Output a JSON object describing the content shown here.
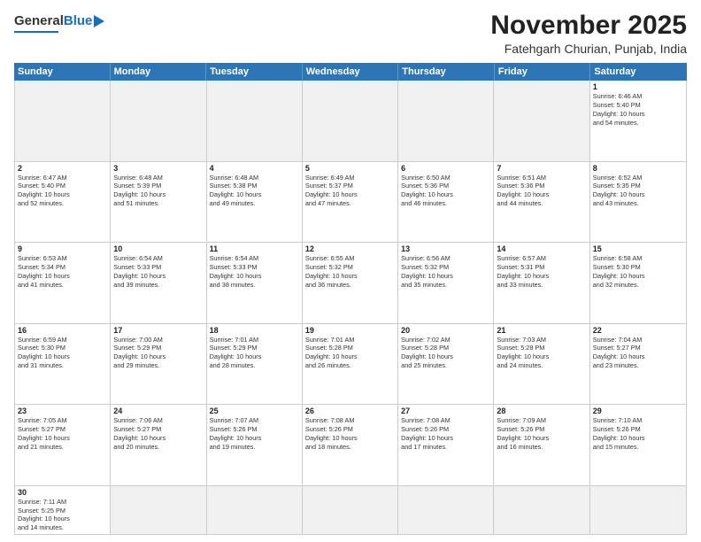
{
  "header": {
    "logo": {
      "general": "General",
      "blue": "Blue"
    },
    "month_title": "November 2025",
    "subtitle": "Fatehgarh Churian, Punjab, India"
  },
  "weekdays": [
    "Sunday",
    "Monday",
    "Tuesday",
    "Wednesday",
    "Thursday",
    "Friday",
    "Saturday"
  ],
  "rows": [
    [
      {
        "day": "",
        "text": "",
        "empty": true
      },
      {
        "day": "",
        "text": "",
        "empty": true
      },
      {
        "day": "",
        "text": "",
        "empty": true
      },
      {
        "day": "",
        "text": "",
        "empty": true
      },
      {
        "day": "",
        "text": "",
        "empty": true
      },
      {
        "day": "",
        "text": "",
        "empty": true
      },
      {
        "day": "1",
        "text": "Sunrise: 6:46 AM\nSunset: 5:40 PM\nDaylight: 10 hours\nand 54 minutes.",
        "empty": false
      }
    ],
    [
      {
        "day": "2",
        "text": "Sunrise: 6:47 AM\nSunset: 5:40 PM\nDaylight: 10 hours\nand 52 minutes.",
        "empty": false
      },
      {
        "day": "3",
        "text": "Sunrise: 6:48 AM\nSunset: 5:39 PM\nDaylight: 10 hours\nand 51 minutes.",
        "empty": false
      },
      {
        "day": "4",
        "text": "Sunrise: 6:48 AM\nSunset: 5:38 PM\nDaylight: 10 hours\nand 49 minutes.",
        "empty": false
      },
      {
        "day": "5",
        "text": "Sunrise: 6:49 AM\nSunset: 5:37 PM\nDaylight: 10 hours\nand 47 minutes.",
        "empty": false
      },
      {
        "day": "6",
        "text": "Sunrise: 6:50 AM\nSunset: 5:36 PM\nDaylight: 10 hours\nand 46 minutes.",
        "empty": false
      },
      {
        "day": "7",
        "text": "Sunrise: 6:51 AM\nSunset: 5:36 PM\nDaylight: 10 hours\nand 44 minutes.",
        "empty": false
      },
      {
        "day": "8",
        "text": "Sunrise: 6:52 AM\nSunset: 5:35 PM\nDaylight: 10 hours\nand 43 minutes.",
        "empty": false
      }
    ],
    [
      {
        "day": "9",
        "text": "Sunrise: 6:53 AM\nSunset: 5:34 PM\nDaylight: 10 hours\nand 41 minutes.",
        "empty": false
      },
      {
        "day": "10",
        "text": "Sunrise: 6:54 AM\nSunset: 5:33 PM\nDaylight: 10 hours\nand 39 minutes.",
        "empty": false
      },
      {
        "day": "11",
        "text": "Sunrise: 6:54 AM\nSunset: 5:33 PM\nDaylight: 10 hours\nand 38 minutes.",
        "empty": false
      },
      {
        "day": "12",
        "text": "Sunrise: 6:55 AM\nSunset: 5:32 PM\nDaylight: 10 hours\nand 36 minutes.",
        "empty": false
      },
      {
        "day": "13",
        "text": "Sunrise: 6:56 AM\nSunset: 5:32 PM\nDaylight: 10 hours\nand 35 minutes.",
        "empty": false
      },
      {
        "day": "14",
        "text": "Sunrise: 6:57 AM\nSunset: 5:31 PM\nDaylight: 10 hours\nand 33 minutes.",
        "empty": false
      },
      {
        "day": "15",
        "text": "Sunrise: 6:58 AM\nSunset: 5:30 PM\nDaylight: 10 hours\nand 32 minutes.",
        "empty": false
      }
    ],
    [
      {
        "day": "16",
        "text": "Sunrise: 6:59 AM\nSunset: 5:30 PM\nDaylight: 10 hours\nand 31 minutes.",
        "empty": false
      },
      {
        "day": "17",
        "text": "Sunrise: 7:00 AM\nSunset: 5:29 PM\nDaylight: 10 hours\nand 29 minutes.",
        "empty": false
      },
      {
        "day": "18",
        "text": "Sunrise: 7:01 AM\nSunset: 5:29 PM\nDaylight: 10 hours\nand 28 minutes.",
        "empty": false
      },
      {
        "day": "19",
        "text": "Sunrise: 7:01 AM\nSunset: 5:28 PM\nDaylight: 10 hours\nand 26 minutes.",
        "empty": false
      },
      {
        "day": "20",
        "text": "Sunrise: 7:02 AM\nSunset: 5:28 PM\nDaylight: 10 hours\nand 25 minutes.",
        "empty": false
      },
      {
        "day": "21",
        "text": "Sunrise: 7:03 AM\nSunset: 5:28 PM\nDaylight: 10 hours\nand 24 minutes.",
        "empty": false
      },
      {
        "day": "22",
        "text": "Sunrise: 7:04 AM\nSunset: 5:27 PM\nDaylight: 10 hours\nand 23 minutes.",
        "empty": false
      }
    ],
    [
      {
        "day": "23",
        "text": "Sunrise: 7:05 AM\nSunset: 5:27 PM\nDaylight: 10 hours\nand 21 minutes.",
        "empty": false
      },
      {
        "day": "24",
        "text": "Sunrise: 7:06 AM\nSunset: 5:27 PM\nDaylight: 10 hours\nand 20 minutes.",
        "empty": false
      },
      {
        "day": "25",
        "text": "Sunrise: 7:07 AM\nSunset: 5:26 PM\nDaylight: 10 hours\nand 19 minutes.",
        "empty": false
      },
      {
        "day": "26",
        "text": "Sunrise: 7:08 AM\nSunset: 5:26 PM\nDaylight: 10 hours\nand 18 minutes.",
        "empty": false
      },
      {
        "day": "27",
        "text": "Sunrise: 7:08 AM\nSunset: 5:26 PM\nDaylight: 10 hours\nand 17 minutes.",
        "empty": false
      },
      {
        "day": "28",
        "text": "Sunrise: 7:09 AM\nSunset: 5:26 PM\nDaylight: 10 hours\nand 16 minutes.",
        "empty": false
      },
      {
        "day": "29",
        "text": "Sunrise: 7:10 AM\nSunset: 5:26 PM\nDaylight: 10 hours\nand 15 minutes.",
        "empty": false
      }
    ],
    [
      {
        "day": "30",
        "text": "Sunrise: 7:11 AM\nSunset: 5:25 PM\nDaylight: 10 hours\nand 14 minutes.",
        "empty": false
      },
      {
        "day": "",
        "text": "",
        "empty": true
      },
      {
        "day": "",
        "text": "",
        "empty": true
      },
      {
        "day": "",
        "text": "",
        "empty": true
      },
      {
        "day": "",
        "text": "",
        "empty": true
      },
      {
        "day": "",
        "text": "",
        "empty": true
      },
      {
        "day": "",
        "text": "",
        "empty": true
      }
    ]
  ]
}
